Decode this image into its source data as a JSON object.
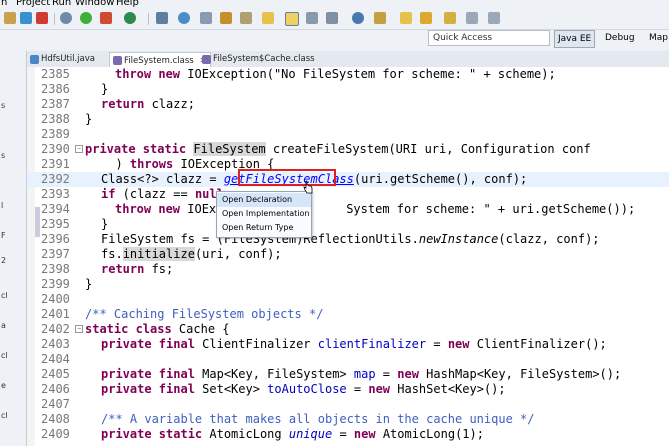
{
  "menu": [
    "h",
    "Project",
    "Run",
    "Window",
    "Help"
  ],
  "search": {
    "placeholder": "Quick Access"
  },
  "perspectives": [
    "Java EE",
    "Debug",
    "Map"
  ],
  "tabs": [
    {
      "label": "HdfsUtil.java"
    },
    {
      "label": "FileSystem.class",
      "close": "✕"
    },
    {
      "label": "FileSystem$Cache.class"
    }
  ],
  "left_strip": [
    "s",
    "s",
    "l",
    "F",
    "2",
    "cl",
    "a",
    "cl",
    "e",
    "cl"
  ],
  "code_lines": [
    {
      "n": "2385",
      "text": "throw new IOException(\"No FileSystem for scheme: \" + scheme);"
    },
    {
      "n": "2386",
      "text": "}"
    },
    {
      "n": "2387",
      "text": "return clazz;"
    },
    {
      "n": "2388",
      "text": "}"
    },
    {
      "n": "2389",
      "text": ""
    },
    {
      "n": "2390",
      "text": "private static FileSystem createFileSystem(URI uri, Configuration conf"
    },
    {
      "n": "2391",
      "text": "  ) throws IOException {"
    },
    {
      "n": "2392",
      "text": "Class<?> clazz = getFileSystemClass(uri.getScheme(), conf);"
    },
    {
      "n": "2393",
      "text": "if (clazz == null"
    },
    {
      "n": "2394",
      "text": "  throw new IOExce                System for scheme: \" + uri.getScheme());"
    },
    {
      "n": "2395",
      "text": "}"
    },
    {
      "n": "2396",
      "text": "FileSystem fs = (FileSystem)ReflectionUtils.newInstance(clazz, conf);"
    },
    {
      "n": "2397",
      "text": "fs.initialize(uri, conf);"
    },
    {
      "n": "2398",
      "text": "return fs;"
    },
    {
      "n": "2399",
      "text": "}"
    },
    {
      "n": "2400",
      "text": ""
    },
    {
      "n": "2401",
      "text": "/** Caching FileSystem objects */"
    },
    {
      "n": "2402",
      "text": "static class Cache {"
    },
    {
      "n": "2403",
      "text": "private final ClientFinalizer clientFinalizer = new ClientFinalizer();"
    },
    {
      "n": "2404",
      "text": ""
    },
    {
      "n": "2405",
      "text": "private final Map<Key, FileSystem> map = new HashMap<Key, FileSystem>();"
    },
    {
      "n": "2406",
      "text": "private final Set<Key> toAutoClose = new HashSet<Key>();"
    },
    {
      "n": "2407",
      "text": ""
    },
    {
      "n": "2408",
      "text": "/** A variable that makes all objects in the cache unique */"
    },
    {
      "n": "2409",
      "text": "private static AtomicLong unique = new AtomicLong(1);"
    }
  ],
  "popup": [
    "Open Declaration",
    "Open Implementation",
    "Open Return Type"
  ],
  "colors": {
    "keyword": "#7f0055",
    "comment": "#3f5fbf",
    "link": "#0000ff",
    "highlight": "#e8f2fe",
    "redbox": "#e02020"
  }
}
